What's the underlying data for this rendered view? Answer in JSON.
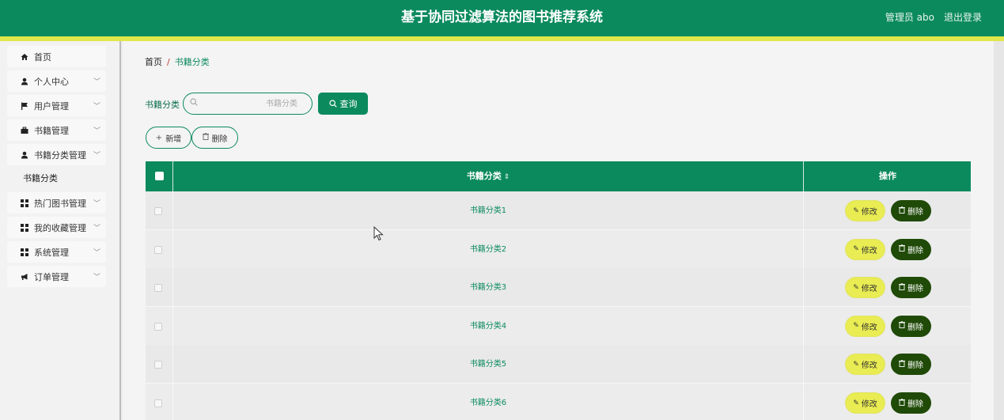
{
  "header": {
    "title": "基于协同过滤算法的图书推荐系统",
    "user": "管理员 abo",
    "logout": "退出登录"
  },
  "sidebar": {
    "items": [
      {
        "label": "首页",
        "icon": "home-icon"
      },
      {
        "label": "个人中心",
        "icon": "user-icon"
      },
      {
        "label": "用户管理",
        "icon": "flag-icon"
      },
      {
        "label": "书籍管理",
        "icon": "briefcase-icon"
      },
      {
        "label": "书籍分类管理",
        "icon": "user-icon"
      },
      {
        "label": "热门图书管理",
        "icon": "grid-icon"
      },
      {
        "label": "我的收藏管理",
        "icon": "grid-icon"
      },
      {
        "label": "系统管理",
        "icon": "grid-icon"
      },
      {
        "label": "订单管理",
        "icon": "megaphone-icon"
      }
    ],
    "subitem": "书籍分类"
  },
  "breadcrumb": {
    "home": "首页",
    "separator": "/",
    "current": "书籍分类"
  },
  "filter": {
    "label": "书籍分类",
    "placeholder": "书籍分类",
    "query_label": "查询"
  },
  "actions": {
    "add_label": "新增",
    "delete_label": "删除"
  },
  "table": {
    "columns": [
      "书籍分类",
      "操作"
    ],
    "rows": [
      "书籍分类1",
      "书籍分类2",
      "书籍分类3",
      "书籍分类4",
      "书籍分类5",
      "书籍分类6"
    ],
    "edit_label": "修改",
    "remove_label": "删除"
  },
  "colors": {
    "primary": "#0b8a5e",
    "stripe": "#dfe84a",
    "edit": "#e9ec52",
    "remove": "#1f4a07"
  }
}
